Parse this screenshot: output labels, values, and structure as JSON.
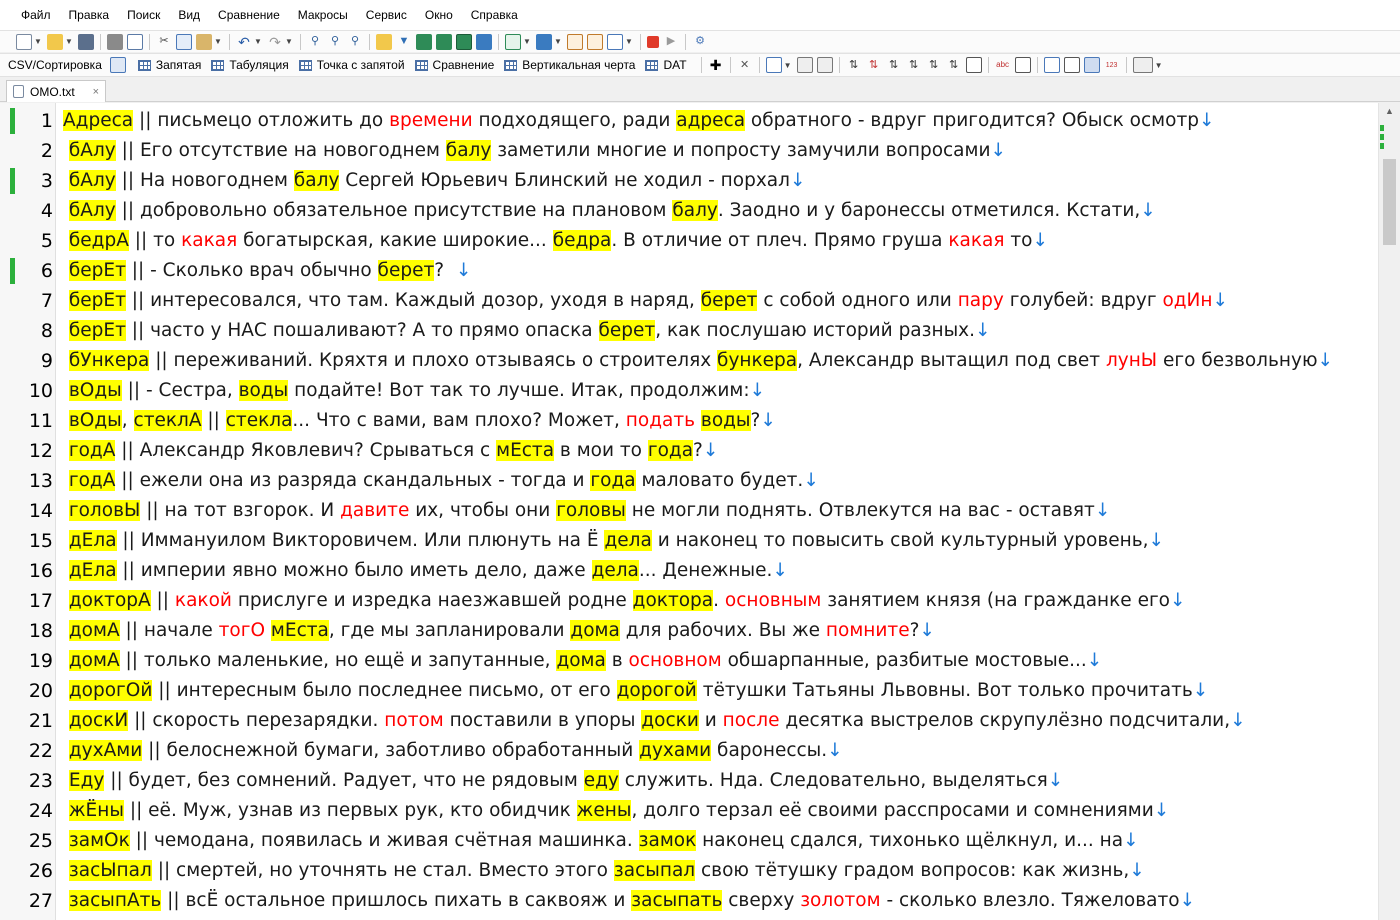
{
  "menu": [
    "Файл",
    "Правка",
    "Поиск",
    "Вид",
    "Сравнение",
    "Макросы",
    "Сервис",
    "Окно",
    "Справка"
  ],
  "toolbar2": {
    "csv_label": "CSV/Сортировка",
    "items": [
      "Запятая",
      "Табуляция",
      "Точка с запятой",
      "Сравнение",
      "Вертикальная черта",
      "DAT"
    ]
  },
  "tab": {
    "title": "OMO.txt",
    "close": "×"
  },
  "colors": {
    "highlight": "#ffff00",
    "red": "#ff0000",
    "eol": "#1e7ad8",
    "marker": "#2cb03c"
  },
  "editor": {
    "lines": [
      {
        "num": "1",
        "mark": true,
        "segs": [
          {
            "t": "Адреса",
            "c": "hl"
          },
          {
            "t": " || письмецо отложить до "
          },
          {
            "t": "времени",
            "c": "red"
          },
          {
            "t": " подходящего, ради "
          },
          {
            "t": "адреса",
            "c": "hl"
          },
          {
            "t": " обратного - вдруг пригодится? Обыск осмотр"
          },
          {
            "t": "↓",
            "c": "eol"
          }
        ]
      },
      {
        "num": "2",
        "segs": [
          {
            "t": " "
          },
          {
            "t": "бАлу",
            "c": "hl"
          },
          {
            "t": " || Его отсутствие на новогоднем "
          },
          {
            "t": "балу",
            "c": "hl"
          },
          {
            "t": " заметили многие и попросту замучили вопросами"
          },
          {
            "t": "↓",
            "c": "eol"
          }
        ]
      },
      {
        "num": "3",
        "mark": true,
        "segs": [
          {
            "t": " "
          },
          {
            "t": "бАлу",
            "c": "hl"
          },
          {
            "t": " || На новогоднем "
          },
          {
            "t": "балу",
            "c": "hl"
          },
          {
            "t": " Сергей Юрьевич Блинский не ходил - порхал"
          },
          {
            "t": "↓",
            "c": "eol"
          }
        ]
      },
      {
        "num": "4",
        "segs": [
          {
            "t": " "
          },
          {
            "t": "бАлу",
            "c": "hl"
          },
          {
            "t": " || добровольно обязательное присутствие на плановом "
          },
          {
            "t": "балу",
            "c": "hl"
          },
          {
            "t": ". Заодно и у баронессы отметился. Кстати,"
          },
          {
            "t": "↓",
            "c": "eol"
          }
        ]
      },
      {
        "num": "5",
        "segs": [
          {
            "t": " "
          },
          {
            "t": "бедрА",
            "c": "hl"
          },
          {
            "t": " || то "
          },
          {
            "t": "какая",
            "c": "red"
          },
          {
            "t": " богатырская, какие широкие... "
          },
          {
            "t": "бедра",
            "c": "hl"
          },
          {
            "t": ". В отличие от плеч. Прямо груша "
          },
          {
            "t": "какая",
            "c": "red"
          },
          {
            "t": " то"
          },
          {
            "t": "↓",
            "c": "eol"
          }
        ]
      },
      {
        "num": "6",
        "mark": true,
        "segs": [
          {
            "t": " "
          },
          {
            "t": "берЕт",
            "c": "hl"
          },
          {
            "t": " || - Сколько врач обычно "
          },
          {
            "t": "берет",
            "c": "hl"
          },
          {
            "t": "?  "
          },
          {
            "t": "↓",
            "c": "eol"
          }
        ]
      },
      {
        "num": "7",
        "segs": [
          {
            "t": " "
          },
          {
            "t": "берЕт",
            "c": "hl"
          },
          {
            "t": " || интересовался, что там. Каждый дозор, уходя в наряд, "
          },
          {
            "t": "берет",
            "c": "hl"
          },
          {
            "t": " с собой одного или "
          },
          {
            "t": "пару",
            "c": "red"
          },
          {
            "t": " голубей: вдруг "
          },
          {
            "t": "одИн",
            "c": "red"
          },
          {
            "t": "↓",
            "c": "eol"
          }
        ]
      },
      {
        "num": "8",
        "segs": [
          {
            "t": " "
          },
          {
            "t": "берЕт",
            "c": "hl"
          },
          {
            "t": " || часто у НАС пошаливают? А то прямо опаска "
          },
          {
            "t": "берет",
            "c": "hl"
          },
          {
            "t": ", как послушаю историй разных."
          },
          {
            "t": "↓",
            "c": "eol"
          }
        ]
      },
      {
        "num": "9",
        "segs": [
          {
            "t": " "
          },
          {
            "t": "бУнкера",
            "c": "hl"
          },
          {
            "t": " || переживаний. Кряхтя и плохо отзываясь о строителях "
          },
          {
            "t": "бункера",
            "c": "hl"
          },
          {
            "t": ", Александр вытащил под свет "
          },
          {
            "t": "лунЫ",
            "c": "red"
          },
          {
            "t": " его безвольную"
          },
          {
            "t": "↓",
            "c": "eol"
          }
        ]
      },
      {
        "num": "10",
        "segs": [
          {
            "t": " "
          },
          {
            "t": "вОды",
            "c": "hl"
          },
          {
            "t": " || - Сестра, "
          },
          {
            "t": "воды",
            "c": "hl"
          },
          {
            "t": " подайте! Вот так то лучше. Итак, продолжим:"
          },
          {
            "t": "↓",
            "c": "eol"
          }
        ]
      },
      {
        "num": "11",
        "segs": [
          {
            "t": " "
          },
          {
            "t": "вОды",
            "c": "hl"
          },
          {
            "t": ", "
          },
          {
            "t": "стеклА",
            "c": "hl"
          },
          {
            "t": " || "
          },
          {
            "t": "стекла",
            "c": "hl"
          },
          {
            "t": "... Что с вами, вам плохо? Может, "
          },
          {
            "t": "подать",
            "c": "red"
          },
          {
            "t": " "
          },
          {
            "t": "воды",
            "c": "hl"
          },
          {
            "t": "?"
          },
          {
            "t": "↓",
            "c": "eol"
          }
        ]
      },
      {
        "num": "12",
        "segs": [
          {
            "t": " "
          },
          {
            "t": "годА",
            "c": "hl"
          },
          {
            "t": " || Александр Яковлевич? Срываться с "
          },
          {
            "t": "мЕста",
            "c": "hl"
          },
          {
            "t": " в мои то "
          },
          {
            "t": "года",
            "c": "hl"
          },
          {
            "t": "?"
          },
          {
            "t": "↓",
            "c": "eol"
          }
        ]
      },
      {
        "num": "13",
        "segs": [
          {
            "t": " "
          },
          {
            "t": "годА",
            "c": "hl"
          },
          {
            "t": " || ежели она из разряда скандальных - тогда и "
          },
          {
            "t": "года",
            "c": "hl"
          },
          {
            "t": " маловато будет."
          },
          {
            "t": "↓",
            "c": "eol"
          }
        ]
      },
      {
        "num": "14",
        "segs": [
          {
            "t": " "
          },
          {
            "t": "головЫ",
            "c": "hl"
          },
          {
            "t": " || на тот взгорок. И "
          },
          {
            "t": "давите",
            "c": "red"
          },
          {
            "t": " их, чтобы они "
          },
          {
            "t": "головы",
            "c": "hl"
          },
          {
            "t": " не могли поднять. Отвлекутся на вас - оставят"
          },
          {
            "t": "↓",
            "c": "eol"
          }
        ]
      },
      {
        "num": "15",
        "segs": [
          {
            "t": " "
          },
          {
            "t": "дЕла",
            "c": "hl"
          },
          {
            "t": " || Иммануилом Викторовичем. Или плюнуть на Ё "
          },
          {
            "t": "дела",
            "c": "hl"
          },
          {
            "t": " и наконец то повысить свой культурный уровень,"
          },
          {
            "t": "↓",
            "c": "eol"
          }
        ]
      },
      {
        "num": "16",
        "segs": [
          {
            "t": " "
          },
          {
            "t": "дЕла",
            "c": "hl"
          },
          {
            "t": " || империи явно можно было иметь дело, даже "
          },
          {
            "t": "дела",
            "c": "hl"
          },
          {
            "t": "... Денежные."
          },
          {
            "t": "↓",
            "c": "eol"
          }
        ]
      },
      {
        "num": "17",
        "segs": [
          {
            "t": " "
          },
          {
            "t": "докторА",
            "c": "hl"
          },
          {
            "t": " || "
          },
          {
            "t": "какой",
            "c": "red"
          },
          {
            "t": " прислуге и изредка наезжавшей родне "
          },
          {
            "t": "доктора",
            "c": "hl"
          },
          {
            "t": ". "
          },
          {
            "t": "основным",
            "c": "red"
          },
          {
            "t": " занятием князя (на гражданке его"
          },
          {
            "t": "↓",
            "c": "eol"
          }
        ]
      },
      {
        "num": "18",
        "segs": [
          {
            "t": " "
          },
          {
            "t": "домА",
            "c": "hl"
          },
          {
            "t": " || начале "
          },
          {
            "t": "тогО",
            "c": "red"
          },
          {
            "t": " "
          },
          {
            "t": "мЕста",
            "c": "hl"
          },
          {
            "t": ", где мы запланировали "
          },
          {
            "t": "дома",
            "c": "hl"
          },
          {
            "t": " для рабочих. Вы же "
          },
          {
            "t": "помните",
            "c": "red"
          },
          {
            "t": "?"
          },
          {
            "t": "↓",
            "c": "eol"
          }
        ]
      },
      {
        "num": "19",
        "segs": [
          {
            "t": " "
          },
          {
            "t": "домА",
            "c": "hl"
          },
          {
            "t": " || только маленькие, но ещё и запутанные, "
          },
          {
            "t": "дома",
            "c": "hl"
          },
          {
            "t": " в "
          },
          {
            "t": "основном",
            "c": "red"
          },
          {
            "t": " обшарпанные, разбитые мостовые..."
          },
          {
            "t": "↓",
            "c": "eol"
          }
        ]
      },
      {
        "num": "20",
        "segs": [
          {
            "t": " "
          },
          {
            "t": "дорогОй",
            "c": "hl"
          },
          {
            "t": " || интересным было последнее письмо, от его "
          },
          {
            "t": "дорогой",
            "c": "hl"
          },
          {
            "t": " тётушки Татьяны Львовны. Вот только прочитать"
          },
          {
            "t": "↓",
            "c": "eol"
          }
        ]
      },
      {
        "num": "21",
        "segs": [
          {
            "t": " "
          },
          {
            "t": "доскИ",
            "c": "hl"
          },
          {
            "t": " || скорость перезарядки. "
          },
          {
            "t": "потом",
            "c": "red"
          },
          {
            "t": " поставили в упоры "
          },
          {
            "t": "доски",
            "c": "hl"
          },
          {
            "t": " и "
          },
          {
            "t": "после",
            "c": "red"
          },
          {
            "t": " десятка выстрелов скрупулёзно подсчитали,"
          },
          {
            "t": "↓",
            "c": "eol"
          }
        ]
      },
      {
        "num": "22",
        "segs": [
          {
            "t": " "
          },
          {
            "t": "духАми",
            "c": "hl"
          },
          {
            "t": " || белоснежной бумаги, заботливо обработанный "
          },
          {
            "t": "духами",
            "c": "hl"
          },
          {
            "t": " баронессы."
          },
          {
            "t": "↓",
            "c": "eol"
          }
        ]
      },
      {
        "num": "23",
        "segs": [
          {
            "t": " "
          },
          {
            "t": "Еду",
            "c": "hl"
          },
          {
            "t": " || будет, без сомнений. Радует, что не рядовым "
          },
          {
            "t": "еду",
            "c": "hl"
          },
          {
            "t": " служить. Нда. Следовательно, выделяться"
          },
          {
            "t": "↓",
            "c": "eol"
          }
        ]
      },
      {
        "num": "24",
        "segs": [
          {
            "t": " "
          },
          {
            "t": "жЁны",
            "c": "hl"
          },
          {
            "t": " || её. Муж, узнав из первых рук, кто обидчик "
          },
          {
            "t": "жены",
            "c": "hl"
          },
          {
            "t": ", долго терзал её своими расспросами и сомнениями"
          },
          {
            "t": "↓",
            "c": "eol"
          }
        ]
      },
      {
        "num": "25",
        "segs": [
          {
            "t": " "
          },
          {
            "t": "замОк",
            "c": "hl"
          },
          {
            "t": " || чемодана, появилась и живая счётная машинка. "
          },
          {
            "t": "замок",
            "c": "hl"
          },
          {
            "t": " наконец сдался, тихонько щёлкнул, и... на"
          },
          {
            "t": "↓",
            "c": "eol"
          }
        ]
      },
      {
        "num": "26",
        "segs": [
          {
            "t": " "
          },
          {
            "t": "засЫпал",
            "c": "hl"
          },
          {
            "t": " || смертей, но уточнять не стал. Вместо этого "
          },
          {
            "t": "засыпал",
            "c": "hl"
          },
          {
            "t": " свою тётушку градом вопросов: как жизнь,"
          },
          {
            "t": "↓",
            "c": "eol"
          }
        ]
      },
      {
        "num": "27",
        "segs": [
          {
            "t": " "
          },
          {
            "t": "засыпАть",
            "c": "hl"
          },
          {
            "t": " || всЁ остальное пришлось пихать в саквояж и "
          },
          {
            "t": "засыпать",
            "c": "hl"
          },
          {
            "t": " сверху "
          },
          {
            "t": "золотом",
            "c": "red"
          },
          {
            "t": " - сколько влезло. Тяжеловато"
          },
          {
            "t": "↓",
            "c": "eol"
          }
        ]
      }
    ]
  }
}
